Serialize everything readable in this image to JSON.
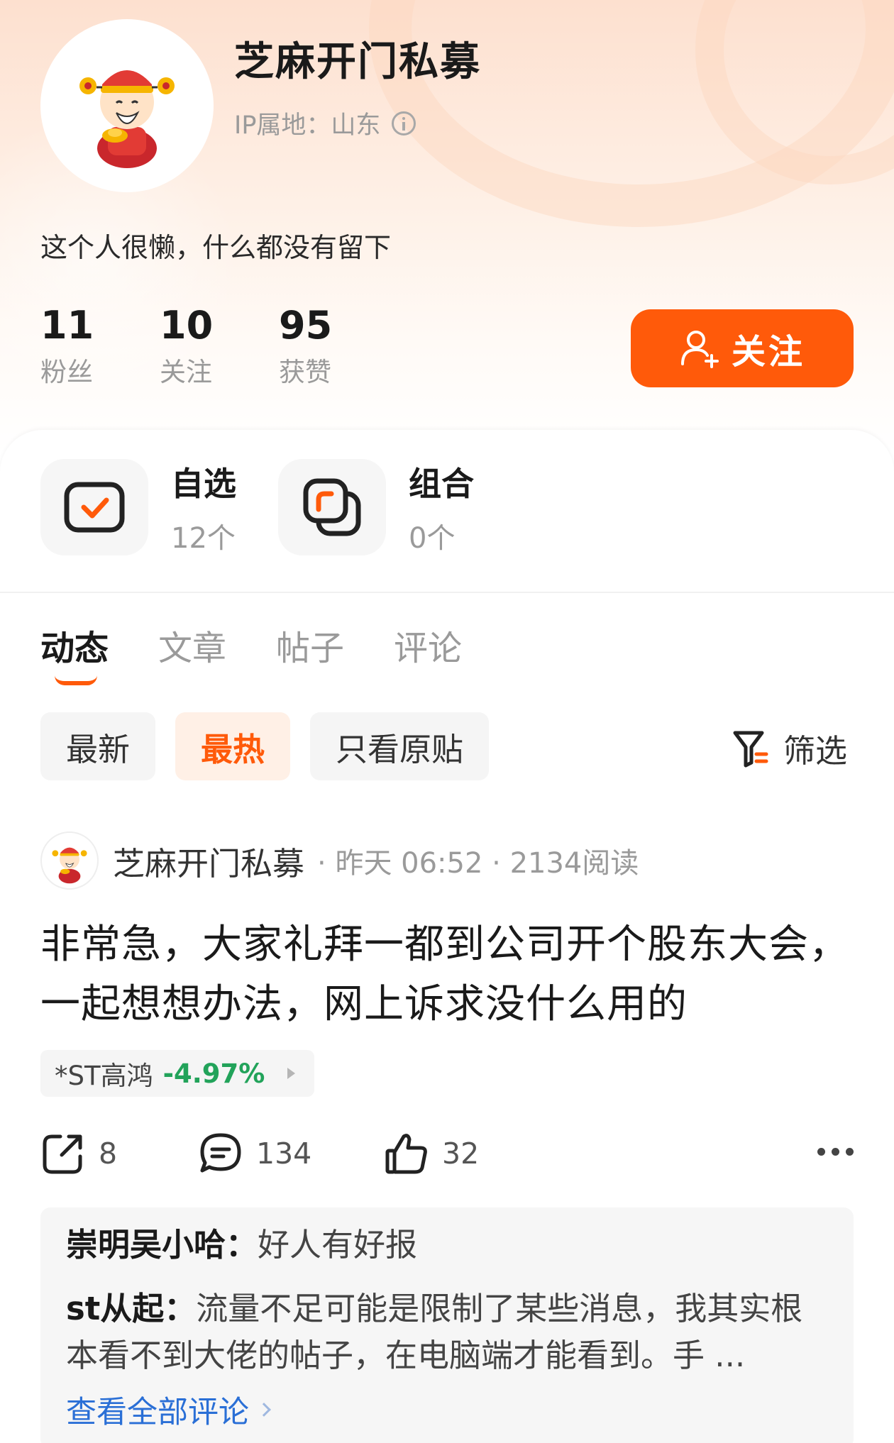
{
  "profile": {
    "name": "芝麻开门私募",
    "ip_location": "IP属地：山东",
    "bio": "这个人很懒，什么都没有留下",
    "stats": [
      {
        "value": "11",
        "label": "粉丝"
      },
      {
        "value": "10",
        "label": "关注"
      },
      {
        "value": "95",
        "label": "获赞"
      }
    ],
    "follow_label": "关注"
  },
  "quick_links": {
    "watchlist": {
      "title": "自选",
      "count": "12个"
    },
    "portfolio": {
      "title": "组合",
      "count": "0个"
    }
  },
  "tabs": [
    "动态",
    "文章",
    "帖子",
    "评论"
  ],
  "active_tab": "动态",
  "filters": {
    "chips": [
      "最新",
      "最热",
      "只看原贴"
    ],
    "active": "最热",
    "screen_label": "筛选"
  },
  "post": {
    "author": "芝麻开门私募",
    "meta": "· 昨天 06:52 · 2134阅读",
    "title": "非常急，大家礼拜一都到公司开个股东大会，一起想想办法，网上诉求没什么用的",
    "stock": {
      "name": "*ST高鸿",
      "change": "-4.97%"
    },
    "shares": "8",
    "comments": "134",
    "likes": "32"
  },
  "comments_preview": [
    {
      "user": "崇明吴小哈：",
      "text": "好人有好报"
    },
    {
      "user": "st从起：",
      "text": "流量不足可能是限制了某些消息，我其实根本看不到大佬的帖子，在电脑端才能看到。手 ..."
    }
  ],
  "view_all_comments": "查看全部评论",
  "colors": {
    "accent": "#ff5a0a",
    "gain_down": "#22a35a",
    "link": "#2a6fd6"
  }
}
